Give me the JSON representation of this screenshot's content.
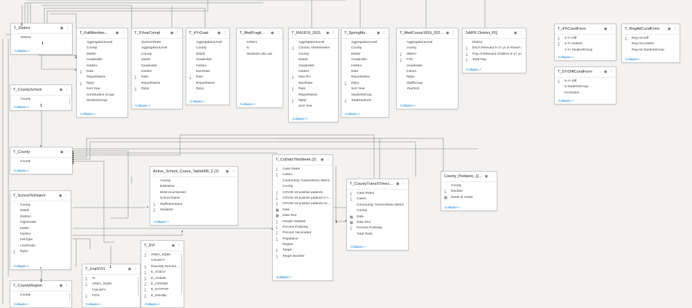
{
  "tables": [
    {
      "id": "district",
      "title": "T_District",
      "fields": [
        {
          "name": "District",
          "agg": false
        }
      ],
      "collapse": "Collapse"
    },
    {
      "id": "fallmember",
      "title": "T_FallMember...",
      "fields": [
        {
          "name": "AggregationLevel",
          "agg": false
        },
        {
          "name": "County",
          "agg": false
        },
        {
          "name": "DistID",
          "agg": false
        },
        {
          "name": "Gradeslvls",
          "agg": false
        },
        {
          "name": "InstNm",
          "agg": false
        },
        {
          "name": "Rate",
          "agg": true
        },
        {
          "name": "ReportName",
          "agg": false
        },
        {
          "name": "Rptyr",
          "agg": true
        },
        {
          "name": "Sort Year",
          "agg": false
        },
        {
          "name": "SortStudent Group",
          "agg": false
        },
        {
          "name": "StudentGroup",
          "agg": false
        }
      ],
      "collapse": "Collapse"
    },
    {
      "id": "fiveyear",
      "title": "T_5YearCompl",
      "fields": [
        {
          "name": "SynSumRate",
          "agg": false
        },
        {
          "name": "AggregationLevel",
          "agg": false
        },
        {
          "name": "County",
          "agg": false
        },
        {
          "name": "DistID",
          "agg": false
        },
        {
          "name": "Gradeslvls",
          "agg": false
        },
        {
          "name": "InstNm",
          "agg": false
        },
        {
          "name": "Rate",
          "agg": true
        },
        {
          "name": "ReportName",
          "agg": false
        },
        {
          "name": "Rptyr",
          "agg": true
        }
      ],
      "collapse": "Collapse"
    },
    {
      "id": "fouryrgrad",
      "title": "T_4YrGrad",
      "fields": [
        {
          "name": "AggregationLevel",
          "agg": false
        },
        {
          "name": "County",
          "agg": false
        },
        {
          "name": "DistID",
          "agg": false
        },
        {
          "name": "Gradeslvls",
          "agg": false
        },
        {
          "name": "InstNm",
          "agg": false
        },
        {
          "name": "NumRate",
          "agg": false
        },
        {
          "name": "Rate",
          "agg": true
        },
        {
          "name": "ReportName",
          "agg": false
        },
        {
          "name": "Rptyr",
          "agg": false
        }
      ],
      "collapse": "Collapse"
    },
    {
      "id": "medfragil",
      "title": "T_MedFragil...",
      "fields": [
        {
          "name": "InstNm",
          "agg": false
        },
        {
          "name": "N",
          "agg": false
        },
        {
          "name": "Students who are",
          "agg": false
        }
      ],
      "collapse": "Collapse"
    },
    {
      "id": "ra1819",
      "title": "T_RA1819_2021",
      "fields": [
        {
          "name": "AggregationLevel",
          "agg": false
        },
        {
          "name": "Chronic Absenteeism",
          "agg": true
        },
        {
          "name": "County",
          "agg": false
        },
        {
          "name": "DistID",
          "agg": false
        },
        {
          "name": "Gradeslvls",
          "agg": false
        },
        {
          "name": "InstNm",
          "agg": false
        },
        {
          "name": "New RA",
          "agg": true
        },
        {
          "name": "NumRate",
          "agg": false
        },
        {
          "name": "Rate",
          "agg": true
        },
        {
          "name": "ReportName",
          "agg": false
        },
        {
          "name": "Rptyr",
          "agg": true
        },
        {
          "name": "Sort Year",
          "agg": false
        }
      ],
      "collapse": "Collapse"
    },
    {
      "id": "springme",
      "title": "T_SpringMe...",
      "fields": [
        {
          "name": "AggregationLevel",
          "agg": false
        },
        {
          "name": "County",
          "agg": false
        },
        {
          "name": "DistID",
          "agg": false
        },
        {
          "name": "Gradeslvls",
          "agg": false
        },
        {
          "name": "InstNm",
          "agg": false
        },
        {
          "name": "Rate",
          "agg": false
        },
        {
          "name": "ReportName",
          "agg": false
        },
        {
          "name": "Rptyr",
          "agg": true
        },
        {
          "name": "Sort Year",
          "agg": false
        },
        {
          "name": "StudentGroup",
          "agg": false
        },
        {
          "name": "TotalStudents",
          "agg": true
        }
      ],
      "collapse": "Collapse"
    },
    {
      "id": "medcouns",
      "title": "T_MedCouns1819_202...",
      "fields": [
        {
          "name": "AggregationLevel",
          "agg": false
        },
        {
          "name": "county",
          "agg": false
        },
        {
          "name": "district",
          "agg": true
        },
        {
          "name": "FTE",
          "agg": true
        },
        {
          "name": "Gradeslvls",
          "agg": false
        },
        {
          "name": "instnm",
          "agg": false
        },
        {
          "name": "Rptyr",
          "agg": false
        },
        {
          "name": "StaffGroup",
          "agg": false
        },
        {
          "name": "YearSort",
          "agg": false
        }
      ],
      "collapse": "Collapse"
    },
    {
      "id": "saipe",
      "title": "SAIPE District_PQ",
      "fields": [
        {
          "name": "District",
          "agg": false
        },
        {
          "name": "Est # Relevant 5-17 yo in Povert...",
          "agg": true
        },
        {
          "name": "Pop of Relevant Children 5-17 yo",
          "agg": true
        },
        {
          "name": "Total Pop",
          "agg": true
        }
      ],
      "collapse": "Collapse"
    },
    {
      "id": "yicondform",
      "title": "T_4YiCondForm",
      "fields": [
        {
          "name": "4-Yr Diff",
          "agg": true
        },
        {
          "name": "4-Yr InstNm",
          "agg": true
        },
        {
          "name": "4-Yr StudentGroup",
          "agg": false
        }
      ],
      "collapse": "Collapse"
    },
    {
      "id": "regatt",
      "title": "T_RegAttCondForm",
      "fields": [
        {
          "name": "Reg Att Diff",
          "agg": true
        },
        {
          "name": "Reg Att InstNm",
          "agg": false
        },
        {
          "name": "Reg Att StudentGroup",
          "agg": false
        }
      ],
      "collapse": "Collapse"
    },
    {
      "id": "syrdiff",
      "title": "T_5YrDiffCondForm",
      "fields": [
        {
          "name": "5-Yr Diff",
          "agg": true
        },
        {
          "name": "5-StudentGroup",
          "agg": false
        },
        {
          "name": "5Yrinstnm",
          "agg": false
        }
      ],
      "collapse": "Collapse"
    },
    {
      "id": "countyschool",
      "title": "T_CountySchool",
      "fields": [
        {
          "name": "County",
          "agg": false
        },
        {
          "name": "District",
          "agg": false
        },
        {
          "name": "StudentGroup",
          "agg": false
        }
      ],
      "collapse": "Collapse"
    },
    {
      "id": "county",
      "title": "T_County",
      "fields": [
        {
          "name": "County",
          "agg": false
        }
      ],
      "collapse": "Collapse"
    },
    {
      "id": "activeschool",
      "title": "Active_School_Cases_Table008_2 (2)",
      "fields": [
        {
          "name": "County",
          "agg": false
        },
        {
          "name": "DistName",
          "agg": false
        },
        {
          "name": "Most-recentonset",
          "agg": false
        },
        {
          "name": "School Name",
          "agg": false
        },
        {
          "name": "StaffVolunteers",
          "agg": true
        },
        {
          "name": "Students",
          "agg": true
        }
      ],
      "collapse": "Collapse"
    },
    {
      "id": "codatothisweek",
      "title": "T_CoDatoThisWeek (2)",
      "fields": [
        {
          "name": "Case Rates",
          "agg": true
        },
        {
          "name": "Cases",
          "agg": true
        },
        {
          "name": "Community Transmission Metric",
          "agg": false
        },
        {
          "name": "County",
          "agg": false
        },
        {
          "name": "COVID-19 positive patients",
          "agg": true
        },
        {
          "name": "COVID-19 positive patients in I...",
          "agg": true
        },
        {
          "name": "COVID-19 positive patients on ...",
          "agg": true
        },
        {
          "name": "Date",
          "agg": "cal"
        },
        {
          "name": "Date Run",
          "agg": "cal"
        },
        {
          "name": "People Initiated",
          "agg": true
        },
        {
          "name": "Percent Positivity",
          "agg": true
        },
        {
          "name": "Percent Vaccinated",
          "agg": true
        },
        {
          "name": "Population",
          "agg": true
        },
        {
          "name": "Region",
          "agg": false
        },
        {
          "name": "Target",
          "agg": true
        },
        {
          "name": "Target Number",
          "agg": true
        }
      ],
      "collapse": "Collapse"
    },
    {
      "id": "countytrans",
      "title": "T_CountyTransXTime1...",
      "fields": [
        {
          "name": "Case Rates",
          "agg": true
        },
        {
          "name": "Cases",
          "agg": true
        },
        {
          "name": "Community Transmission Metric",
          "agg": false
        },
        {
          "name": "County",
          "agg": false
        },
        {
          "name": "Date",
          "agg": "cal"
        },
        {
          "name": "Date Run",
          "agg": "cal"
        },
        {
          "name": "Percent Positivity",
          "agg": true
        },
        {
          "name": "Total Tests",
          "agg": false
        }
      ],
      "collapse": "Collapse"
    },
    {
      "id": "pediatric",
      "title": "County_Pediatric_Que...",
      "fields": [
        {
          "name": "County",
          "agg": false
        },
        {
          "name": "Number",
          "agg": true
        },
        {
          "name": "Week of Onset",
          "agg": "cal"
        }
      ],
      "collapse": "Collapse"
    },
    {
      "id": "schooltodistrict",
      "title": "T_SchoolToDistrict",
      "fields": [
        {
          "name": "County",
          "agg": false
        },
        {
          "name": "DistID",
          "agg": false
        },
        {
          "name": "DistNm",
          "agg": false
        },
        {
          "name": "HighGrade",
          "agg": false
        },
        {
          "name": "InstID",
          "agg": false
        },
        {
          "name": "InstNm",
          "agg": false
        },
        {
          "name": "InstType",
          "agg": false
        },
        {
          "name": "LowGrade",
          "agg": false
        },
        {
          "name": "Rptyr",
          "agg": true
        }
      ],
      "collapse": "Collapse"
    },
    {
      "id": "unpsvi",
      "title": "T_UnpSVI1",
      "fields": [
        {
          "name": "%",
          "agg": true
        },
        {
          "name": "AREA_SQMI",
          "agg": true
        },
        {
          "name": "COUNTY",
          "agg": false
        },
        {
          "name": "FIPS",
          "agg": true
        },
        {
          "name": "LOCATION",
          "agg": false
        }
      ],
      "collapse": "Collapse"
    },
    {
      "id": "svi",
      "title": "T_SVI",
      "fields": [
        {
          "name": "AREA_SQMI",
          "agg": true
        },
        {
          "name": "COUNTY",
          "agg": false
        },
        {
          "name": "Diversity Percent...",
          "agg": true
        },
        {
          "name": "E_AGE17",
          "agg": true
        },
        {
          "name": "E_AGE65",
          "agg": true
        },
        {
          "name": "E_CROWD",
          "agg": true
        },
        {
          "name": "E_DAYPOP",
          "agg": true
        },
        {
          "name": "E_DISABL",
          "agg": true
        },
        {
          "name": "E_GROUPQ",
          "agg": true
        }
      ],
      "collapse": "Collapse"
    },
    {
      "id": "countyregion",
      "title": "T_CountyRegion",
      "fields": [
        {
          "name": "County",
          "agg": false
        },
        {
          "name": "Region",
          "agg": false
        }
      ],
      "collapse": "Collapse"
    }
  ],
  "icons": {
    "visibility": "eye-icon",
    "more": "more-options-icon",
    "sigma": "sigma-icon",
    "calendar": "calendar-icon"
  }
}
